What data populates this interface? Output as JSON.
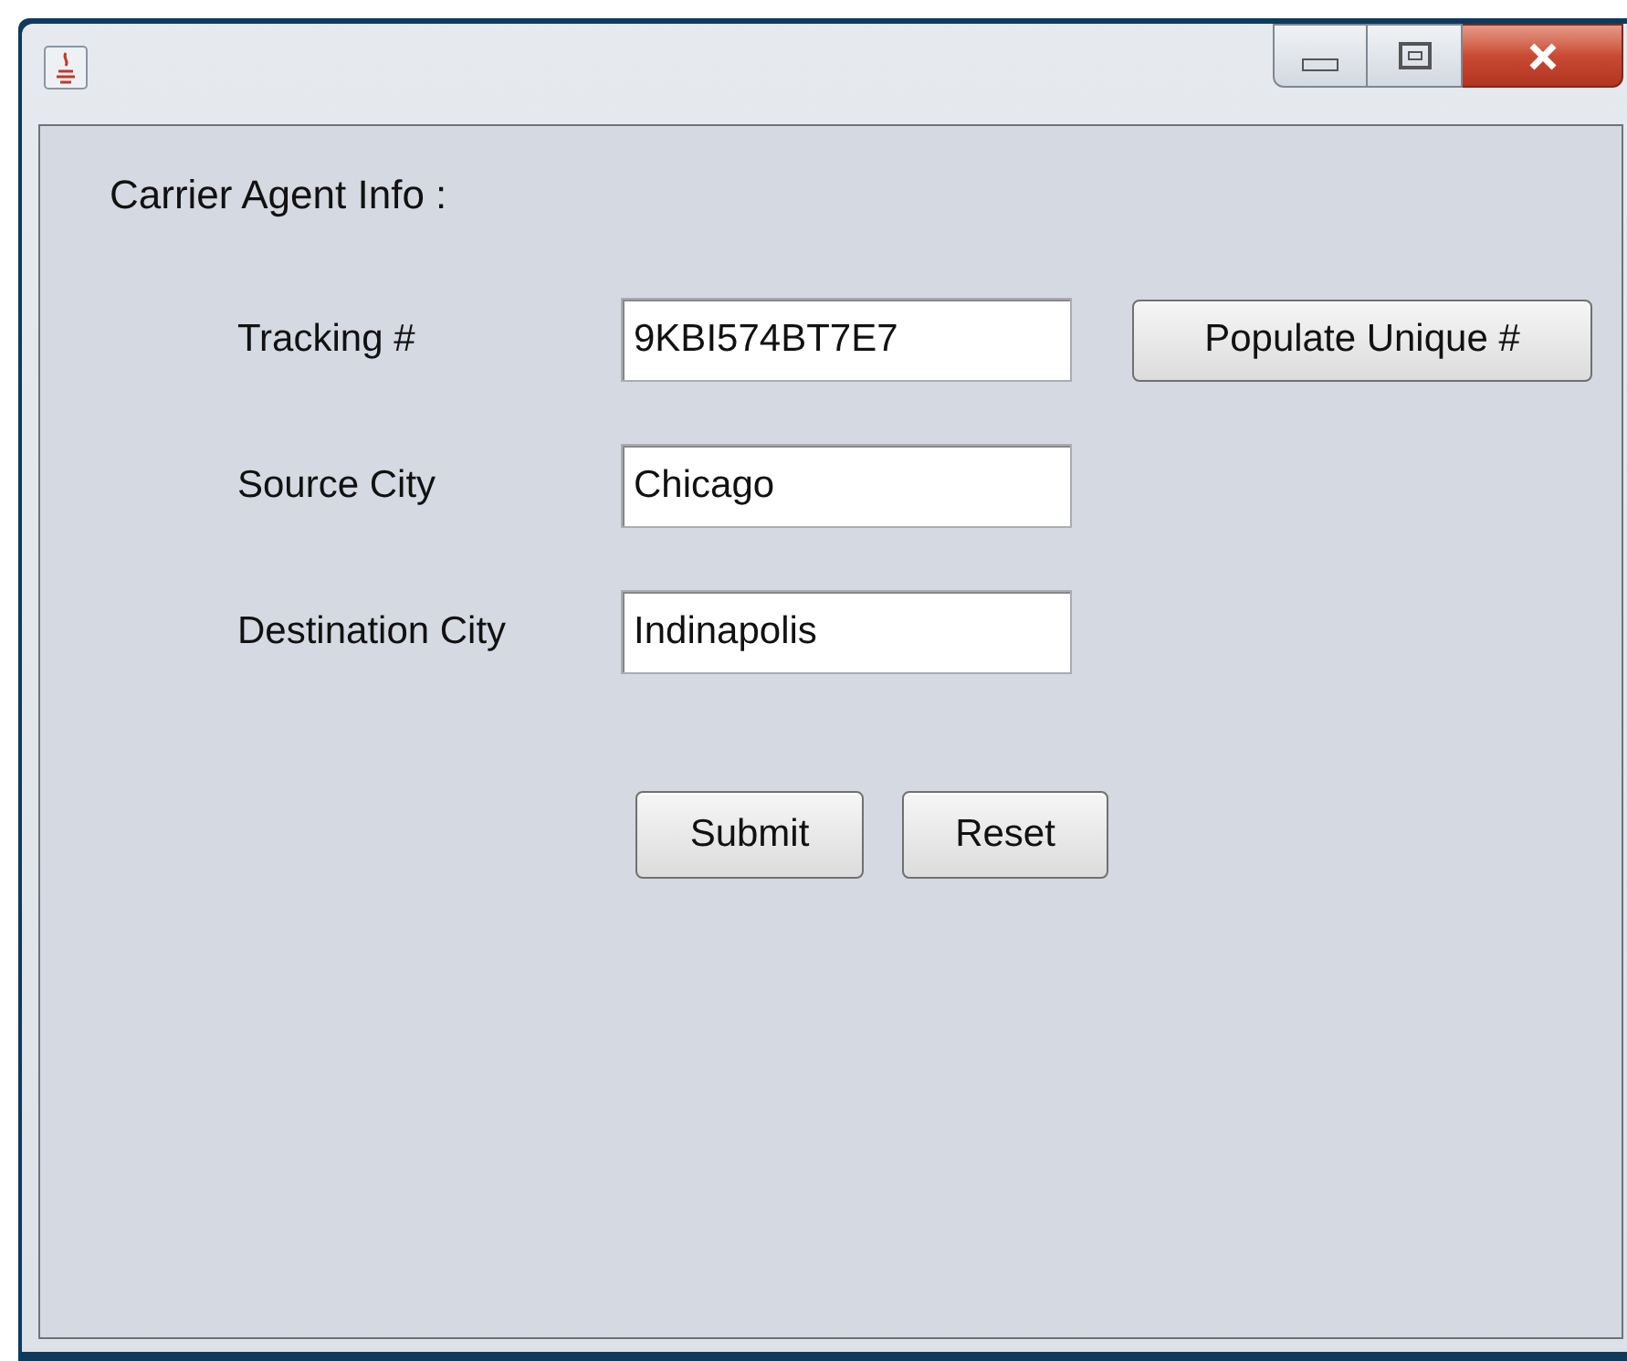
{
  "section_title": "Carrier Agent Info :",
  "fields": [
    {
      "label": "Tracking #",
      "value": "9KBI574BT7E7"
    },
    {
      "label": "Source City",
      "value": "Chicago"
    },
    {
      "label": "Destination City",
      "value": "Indinapolis"
    }
  ],
  "side_button": "Populate Unique #",
  "buttons": [
    "Submit",
    "Reset"
  ]
}
